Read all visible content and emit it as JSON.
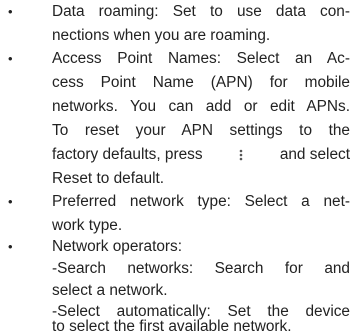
{
  "bullet_glyph": "•",
  "items": [
    {
      "lines": [
        "Data roaming: Set to use data con-",
        "nections when you are roaming."
      ]
    },
    {
      "lines": [
        "Access Point Names: Select an Ac-",
        "cess Point Name (APN) for mobile",
        "networks. You can add or edit APNs.",
        "To reset your APN settings to the"
      ],
      "line5_before_icon": "factory defaults, press",
      "line5_after_icon": "and select",
      "icon": "more-options-icon",
      "line6": "Reset to default."
    },
    {
      "lines": [
        "Preferred network type: Select a net-",
        "work type."
      ]
    },
    {
      "lines": [
        "Network operators:",
        "-Search networks: Search for and",
        "select a network.",
        "-Select automatically: Set the device",
        "to select the first available network."
      ]
    }
  ],
  "colors": {
    "text": "#222222",
    "icon": "#555555"
  }
}
